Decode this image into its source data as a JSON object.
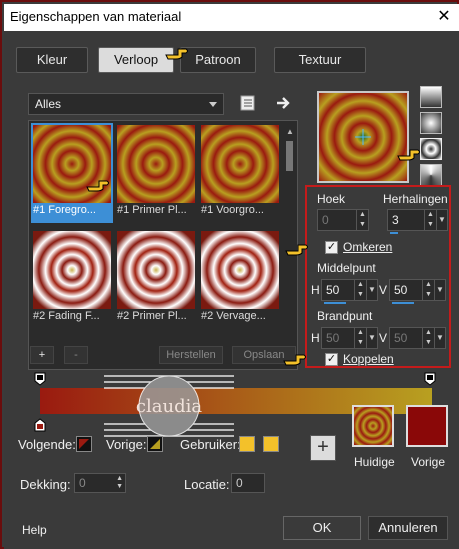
{
  "window": {
    "title": "Eigenschappen van materiaal",
    "close_label": "✕"
  },
  "tabs": [
    {
      "label": "Kleur"
    },
    {
      "label": "Verloop"
    },
    {
      "label": "Patroon"
    },
    {
      "label": "Textuur"
    }
  ],
  "active_tab": "Verloop",
  "category_dropdown": {
    "value": "Alles"
  },
  "gallery": {
    "items": [
      {
        "caption": "#1 Foregro...",
        "style": "rings",
        "selected": true
      },
      {
        "caption": "#1 Primer Pl...",
        "style": "rings",
        "selected": false
      },
      {
        "caption": "#1 Voorgro...",
        "style": "rings",
        "selected": false
      },
      {
        "caption": "#2 Fading F...",
        "style": "rings2",
        "selected": false
      },
      {
        "caption": "#2 Primer Pl...",
        "style": "rings2",
        "selected": false
      },
      {
        "caption": "#2 Vervage...",
        "style": "rings2",
        "selected": false
      }
    ],
    "add_label": "+",
    "remove_label": "-",
    "restore_label": "Herstellen",
    "save_label": "Opslaan"
  },
  "params": {
    "angle_label": "Hoek",
    "angle_value": "0",
    "repeats_label": "Herhalingen",
    "repeats_value": "3",
    "invert_label": "Omkeren",
    "invert_checked": true,
    "center_label": "Middelpunt",
    "center_h_label": "H",
    "center_h": "50",
    "center_v_label": "V",
    "center_v": "50",
    "focal_label": "Brandpunt",
    "focal_h_label": "H",
    "focal_h": "50",
    "focal_v_label": "V",
    "focal_v": "50",
    "link_label": "Koppelen",
    "link_checked": true
  },
  "bottom": {
    "next_label": "Volgende:",
    "prev_label": "Vorige:",
    "user_label": "Gebruiker:",
    "opacity_label": "Dekking:",
    "opacity_value": "0",
    "location_label": "Locatie:",
    "location_value": "0",
    "current_label": "Huidige",
    "previous_label": "Vorige",
    "add_button": "+"
  },
  "footer": {
    "help": "Help",
    "ok": "OK",
    "cancel": "Annuleren"
  },
  "watermark": {
    "text": "claudia"
  },
  "colors": {
    "accent": "#3d8fd6",
    "red": "#9a1a10",
    "gold": "#b8a020",
    "highlight": "#c41b1b",
    "user_swatch": "#f3c12a",
    "previous_swatch": "#8a0808"
  }
}
